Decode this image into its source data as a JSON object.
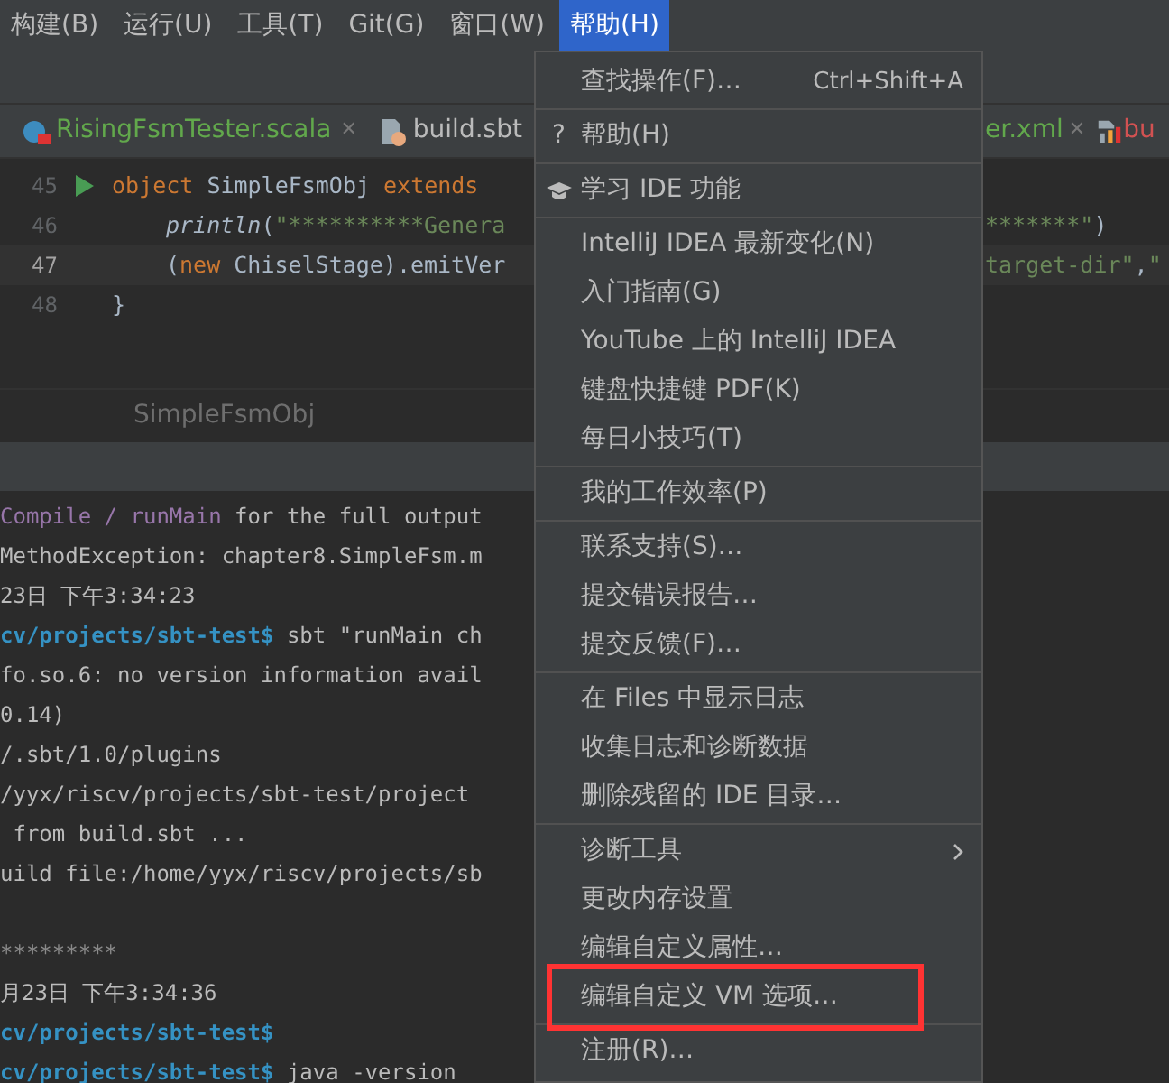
{
  "menubar": [
    {
      "label": "构建(B)",
      "selected": false
    },
    {
      "label": "运行(U)",
      "selected": false
    },
    {
      "label": "工具(T)",
      "selected": false
    },
    {
      "label": "Git(G)",
      "selected": false
    },
    {
      "label": "窗口(W)",
      "selected": false
    },
    {
      "label": "帮助(H)",
      "selected": true
    }
  ],
  "tabs": [
    {
      "label": "RisingFsmTester.scala",
      "color": "#62a84c",
      "kind": "scala",
      "close": "✕"
    },
    {
      "label": "build.sbt",
      "color": "#bbbbbb",
      "kind": "sbt"
    },
    {
      "label": "er.xml",
      "color": "#62a84c",
      "kind": "none",
      "close": "✕"
    },
    {
      "label": "bu",
      "color": "#d25252",
      "kind": "chart"
    }
  ],
  "editor": {
    "lines": [
      {
        "number": "45",
        "run": true,
        "current": false,
        "indented": false,
        "left": [
          {
            "kind": "keyword",
            "text": "object "
          },
          {
            "kind": "plain",
            "text": "SimpleFsmObj "
          },
          {
            "kind": "keyword",
            "text": "extends"
          }
        ]
      },
      {
        "number": "46",
        "run": false,
        "current": false,
        "indented": true,
        "left": [
          {
            "kind": "call",
            "text": "println"
          },
          {
            "kind": "plain",
            "text": "("
          },
          {
            "kind": "string",
            "text": "\"**********Genera"
          }
        ],
        "right": [
          {
            "kind": "string",
            "text": "*******\""
          },
          {
            "kind": "plain",
            "text": ")"
          }
        ]
      },
      {
        "number": "47",
        "run": false,
        "current": true,
        "indented": true,
        "left": [
          {
            "kind": "plain",
            "text": "("
          },
          {
            "kind": "keyword",
            "text": "new "
          },
          {
            "kind": "plain",
            "text": "ChiselStage).emitVer"
          }
        ],
        "right": [
          {
            "kind": "string",
            "text": "target-dir\""
          },
          {
            "kind": "plain",
            "text": ","
          },
          {
            "kind": "string",
            "text": "\""
          }
        ]
      },
      {
        "number": "48",
        "run": false,
        "current": false,
        "indented": false,
        "left": [
          {
            "kind": "plain",
            "text": "}"
          }
        ]
      }
    ]
  },
  "breadcrumb": "SimpleFsmObj",
  "terminal": [
    [
      {
        "segments": [
          {
            "kind": "purple",
            "text": "Compile / runMain"
          },
          {
            "kind": "plain",
            "text": " for the full output"
          }
        ]
      },
      {
        "segments": [
          {
            "kind": "plain",
            "text": "MethodException: chapter8.SimpleFsm.m"
          }
        ]
      },
      {
        "segments": [
          {
            "kind": "plain",
            "text": "23日 下午3:34:23"
          }
        ]
      },
      {
        "segments": [
          {
            "kind": "prompt",
            "text": "cv/projects/sbt-test$"
          },
          {
            "kind": "plain",
            "text": " sbt \"runMain ch"
          }
        ]
      },
      {
        "segments": [
          {
            "kind": "plain",
            "text": "fo.so.6: no version information avail"
          }
        ]
      },
      {
        "segments": [
          {
            "kind": "plain",
            "text": "0.14)"
          }
        ]
      },
      {
        "segments": [
          {
            "kind": "plain",
            "text": "/.sbt/1.0/plugins"
          }
        ]
      },
      {
        "segments": [
          {
            "kind": "plain",
            "text": "/yyx/riscv/projects/sbt-test/project"
          }
        ]
      },
      {
        "segments": [
          {
            "kind": "plain",
            "text": " from build.sbt ..."
          }
        ]
      },
      {
        "segments": [
          {
            "kind": "plain",
            "text": "uild file:/home/yyx/riscv/projects/sb"
          }
        ]
      }
    ],
    [
      {
        "segments": [
          {
            "kind": "dim",
            "text": "*********"
          }
        ]
      },
      {
        "segments": [
          {
            "kind": "plain",
            "text": "月23日 下午3:34:36"
          }
        ]
      },
      {
        "segments": [
          {
            "kind": "prompt",
            "text": "cv/projects/sbt-test$"
          }
        ]
      },
      {
        "segments": [
          {
            "kind": "prompt",
            "text": "cv/projects/sbt-test$"
          },
          {
            "kind": "plain",
            "text": " java -version"
          }
        ]
      }
    ]
  ],
  "help_menu": {
    "groups": [
      [
        {
          "label": "查找操作(F)…",
          "shortcut": "Ctrl+Shift+A",
          "kind": "plain",
          "annotated": false
        }
      ],
      [
        {
          "label": "帮助(H)",
          "prefix": "?",
          "kind": "prefix",
          "annotated": false
        }
      ],
      [
        {
          "label": "学习 IDE 功能",
          "kind": "learn",
          "annotated": false
        }
      ],
      [
        {
          "label": "IntelliJ IDEA 最新变化(N)",
          "kind": "plain",
          "annotated": false
        },
        {
          "label": "入门指南(G)",
          "kind": "plain",
          "annotated": false
        },
        {
          "label": "YouTube 上的 IntelliJ IDEA",
          "kind": "plain",
          "annotated": false
        },
        {
          "label": "键盘快捷键 PDF(K)",
          "kind": "plain",
          "annotated": false
        },
        {
          "label": "每日小技巧(T)",
          "kind": "plain",
          "annotated": false
        }
      ],
      [
        {
          "label": "我的工作效率(P)",
          "kind": "plain",
          "annotated": false
        }
      ],
      [
        {
          "label": "联系支持(S)…",
          "kind": "plain",
          "annotated": false
        },
        {
          "label": "提交错误报告…",
          "kind": "plain",
          "annotated": false
        },
        {
          "label": "提交反馈(F)…",
          "kind": "plain",
          "annotated": false
        }
      ],
      [
        {
          "label": "在 Files 中显示日志",
          "kind": "plain",
          "annotated": false
        },
        {
          "label": "收集日志和诊断数据",
          "kind": "plain",
          "annotated": false
        },
        {
          "label": "删除残留的 IDE 目录…",
          "kind": "plain",
          "annotated": false
        }
      ],
      [
        {
          "label": "诊断工具",
          "kind": "submenu",
          "annotated": false
        },
        {
          "label": "更改内存设置",
          "kind": "plain",
          "annotated": false
        },
        {
          "label": "编辑自定义属性…",
          "kind": "plain",
          "annotated": false
        },
        {
          "label": "编辑自定义 VM 选项…",
          "kind": "plain",
          "annotated": true
        }
      ],
      [
        {
          "label": "注册(R)…",
          "kind": "plain",
          "annotated": false
        }
      ]
    ]
  }
}
